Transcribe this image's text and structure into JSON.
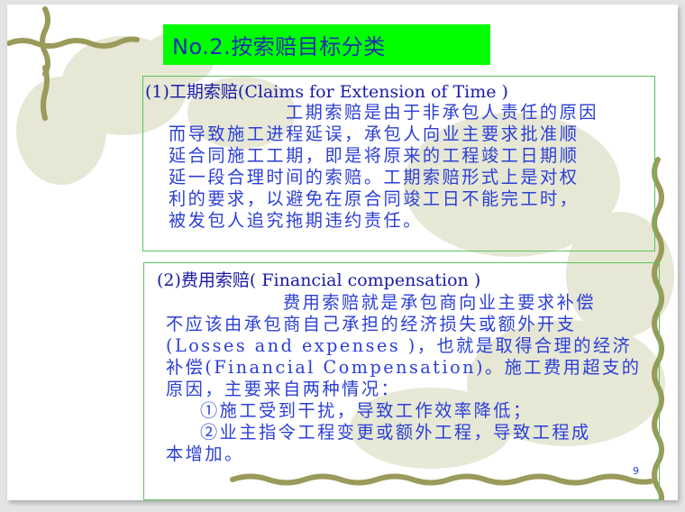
{
  "slide": {
    "title": "No.2.按索赔目标分类",
    "page_number": "9",
    "colors": {
      "title_background": "#00ff00",
      "title_text": "#1a2fb0",
      "body_text": "#2b3fd6",
      "box_border": "#5bc35b",
      "vine": "#9a9a5a"
    },
    "section1": {
      "heading": "(1)工期索赔(Claims for Extension of Time )",
      "lines": [
        "工期索赔是由于非承包人责任的原因",
        "而导致施工进程延误，承包人向业主要求批准顺",
        "延合同施工工期，即是将原来的工程竣工日期顺",
        "延一段合理时间的索赔。工期索赔形式上是对权",
        "利的要求，以避免在原合同竣工日不能完工时，",
        "被发包人追究拖期违约责任。"
      ]
    },
    "section2": {
      "heading": "(2)费用索赔( Financial compensation )",
      "lines": [
        "费用索赔就是承包商向业主要求补偿",
        "不应该由承包商自己承担的经济损失或额外开支",
        "(Losses and expenses )，也就是取得合理的经济",
        "补偿(Financial Compensation)。施工费用超支的",
        "原因，主要来自两种情况："
      ],
      "items": [
        "①施工受到干扰，导致工作效率降低；",
        "②业主指令工程变更或额外工程，导致工程成"
      ],
      "tail": "本增加。"
    }
  }
}
